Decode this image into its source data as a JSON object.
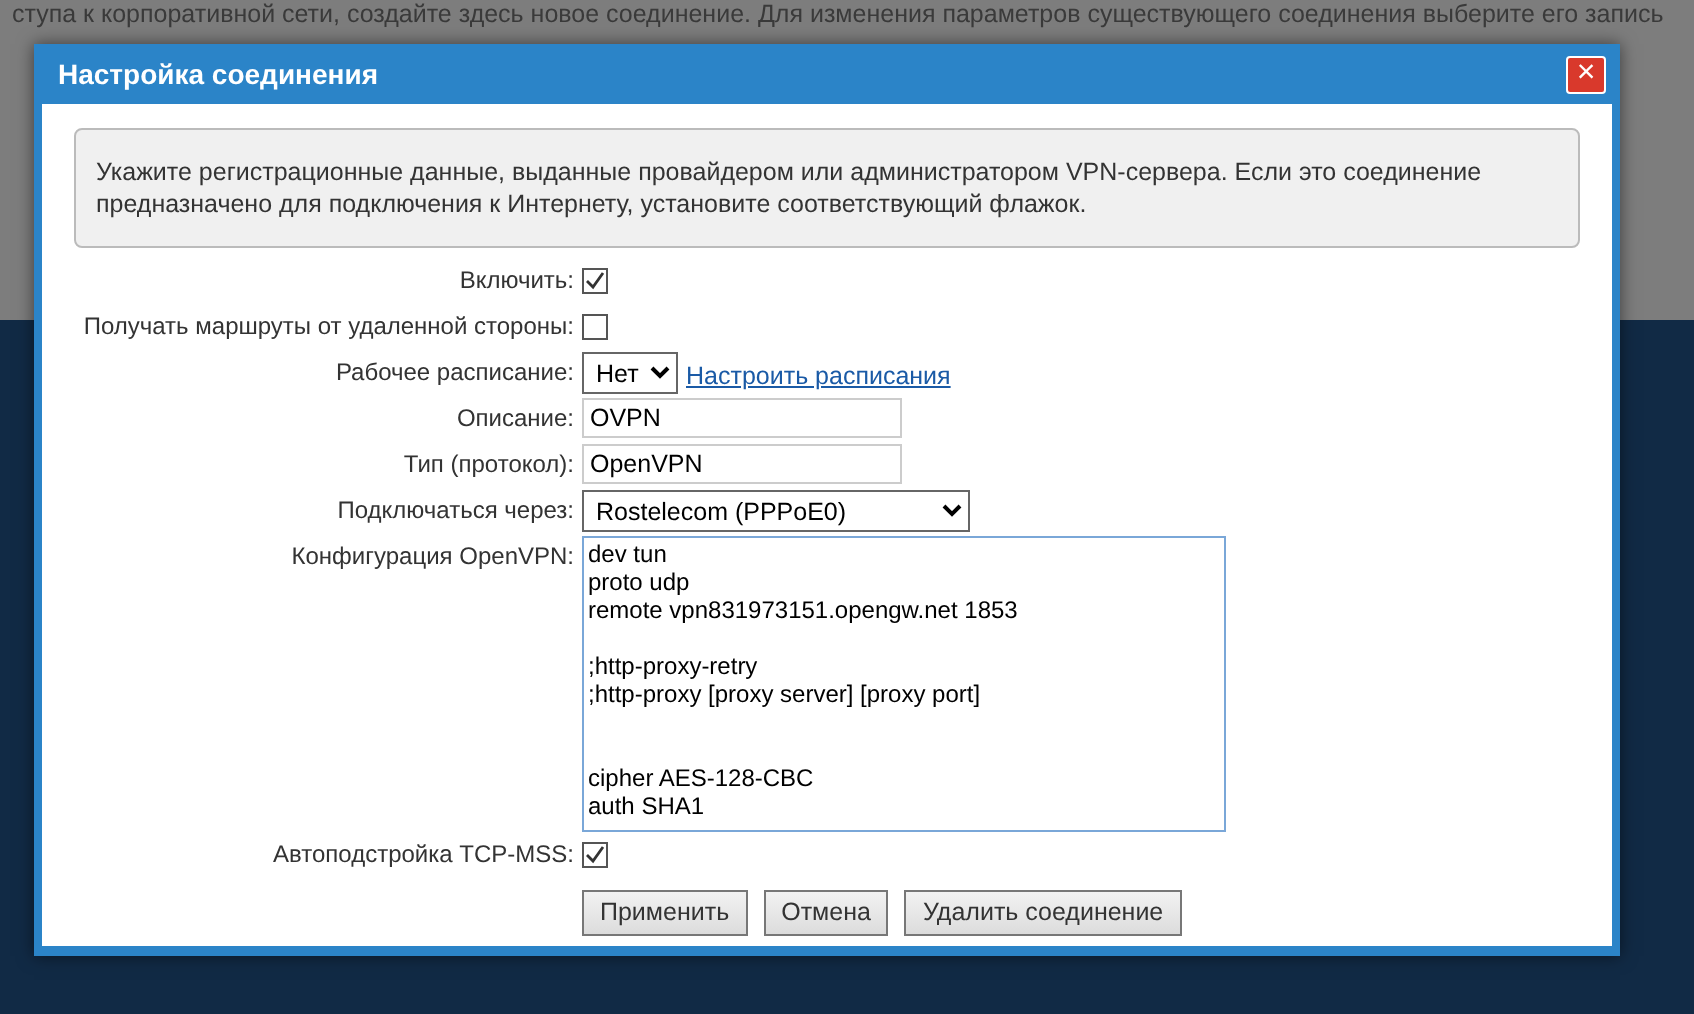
{
  "background": {
    "text": "ступа к корпоративной сети, создайте здесь новое соединение. Для изменения параметров существующего соединения выберите его запись"
  },
  "dialog": {
    "title": "Настройка соединения",
    "close": "×",
    "info": "Укажите регистрационные данные, выданные провайдером или администратором VPN-сервера. Если это соединение предназначено для подключения к Интернету, установите соответствующий флажок.",
    "fields": [
      {
        "kind": "checkbox",
        "label": "Включить:",
        "checked": true
      },
      {
        "kind": "checkbox",
        "label": "Получать маршруты от удаленной стороны:",
        "checked": false
      },
      {
        "kind": "select",
        "label": "Рабочее расписание:",
        "value": "Нет",
        "link": "Настроить расписания"
      },
      {
        "kind": "text",
        "label": "Описание:",
        "value": "OVPN"
      },
      {
        "kind": "text",
        "label": "Тип (протокол):",
        "value": "OpenVPN"
      },
      {
        "kind": "select",
        "label": "Подключаться через:",
        "value": "Rostelecom (PPPoE0)"
      },
      {
        "kind": "textarea",
        "label": "Конфигурация OpenVPN:",
        "value": "dev tun\nproto udp\nremote vpn831973151.opengw.net 1853\n\n;http-proxy-retry\n;http-proxy [proxy server] [proxy port]\n\n\ncipher AES-128-CBC\nauth SHA1"
      },
      {
        "kind": "checkbox",
        "label": "Автоподстройка TCP-MSS:",
        "checked": true
      }
    ],
    "buttons": [
      "Применить",
      "Отмена",
      "Удалить соединение"
    ]
  }
}
